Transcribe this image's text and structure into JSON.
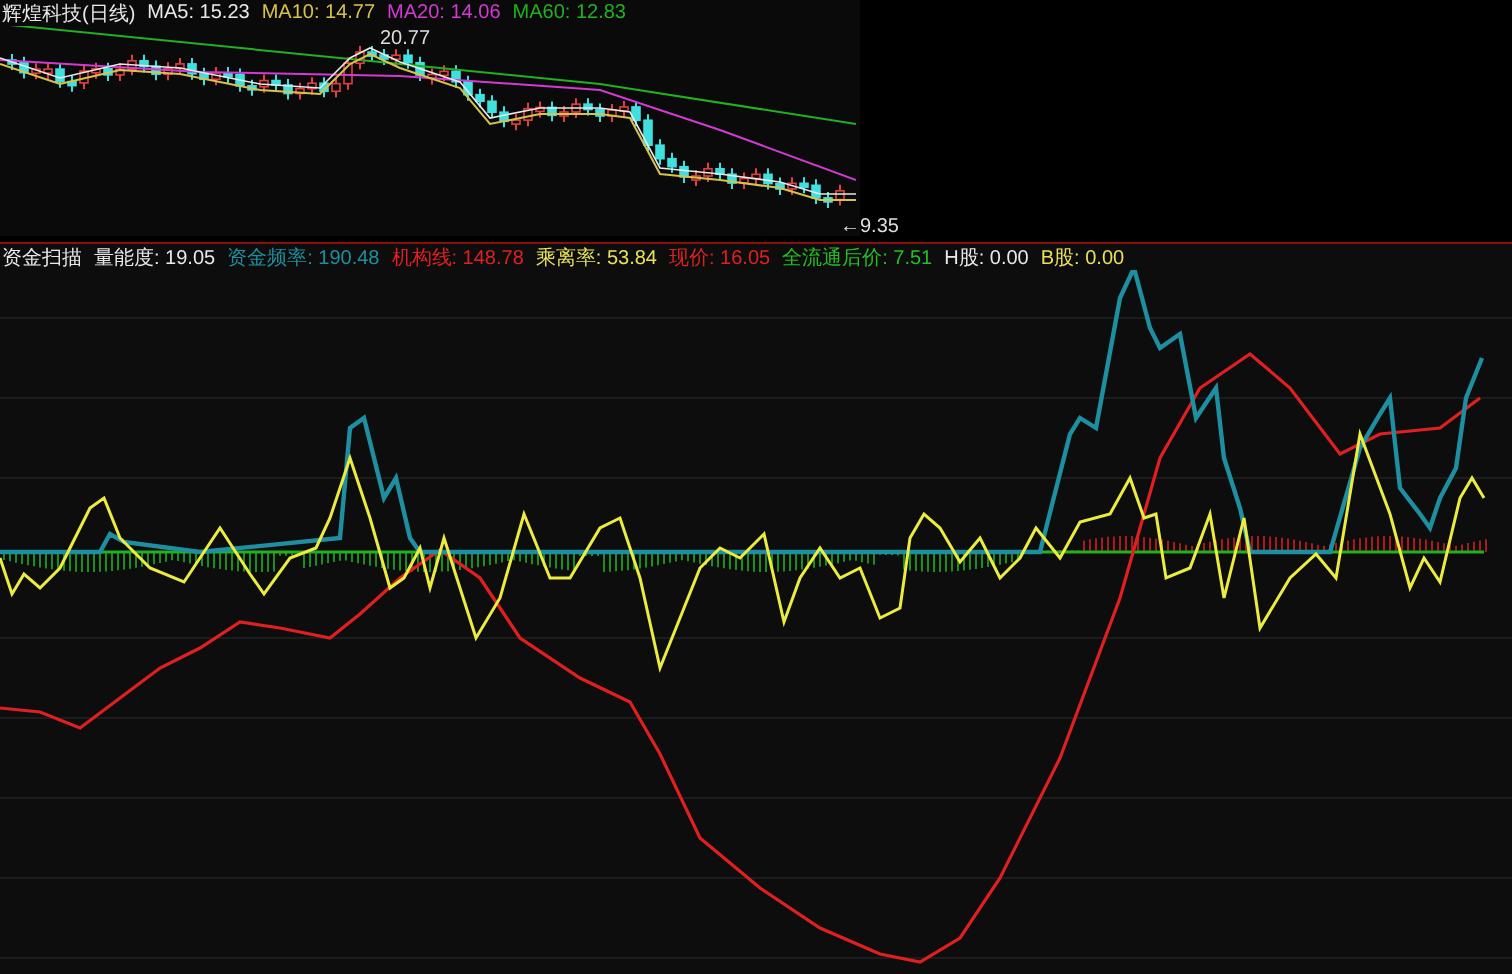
{
  "price_panel": {
    "title": "辉煌科技(日线)",
    "moving_averages": [
      {
        "label": "MA5: 15.23",
        "color": "#e8e8e8"
      },
      {
        "label": "MA10: 14.77",
        "color": "#d9c24a"
      },
      {
        "label": "MA20: 14.06",
        "color": "#d23ad2"
      },
      {
        "label": "MA60: 12.83",
        "color": "#22b022"
      }
    ],
    "high_label": "20.77",
    "low_label": "←9.35"
  },
  "indicator_panel": {
    "title": "资金扫描",
    "readings": [
      {
        "label": "量能度: 19.05",
        "color": "#e8e8e8"
      },
      {
        "label": "资金频率: 190.48",
        "color": "#1e8fa0"
      },
      {
        "label": "机构线: 148.78",
        "color": "#e02020"
      },
      {
        "label": "乘离率: 53.84",
        "color": "#e8e05a"
      },
      {
        "label": "现价: 16.05",
        "color": "#e02020"
      },
      {
        "label": "全流通后价: 7.51",
        "color": "#22c022"
      },
      {
        "label": "H股: 0.00",
        "color": "#e8e8e8"
      },
      {
        "label": "B股: 0.00",
        "color": "#e8e05a"
      }
    ]
  }
}
